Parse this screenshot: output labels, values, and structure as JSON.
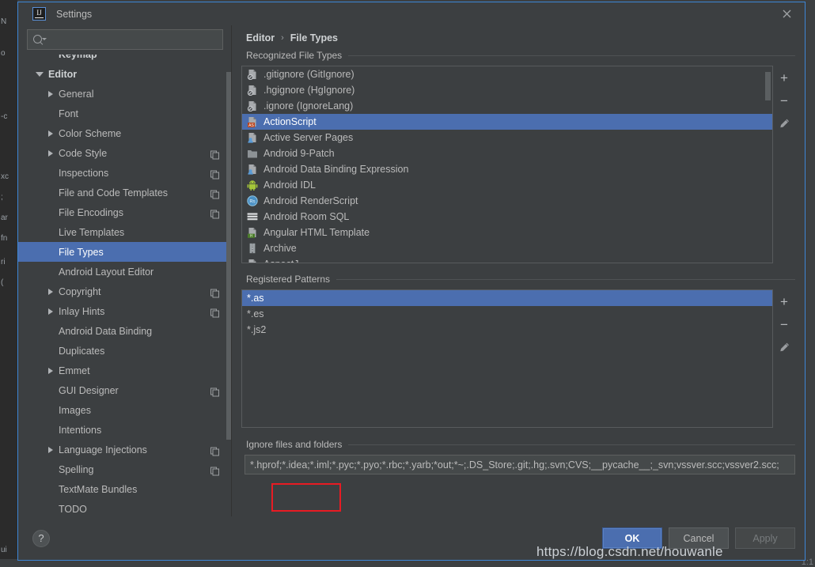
{
  "window": {
    "title": "Settings",
    "logo_text": "IJ",
    "close_icon": "close-icon"
  },
  "search": {
    "value": "",
    "placeholder": "",
    "icon": "search-icon"
  },
  "sidebar": {
    "items": [
      {
        "label": "Keymap",
        "indent": 1,
        "arrow": "none",
        "bold": true,
        "copy": false,
        "selected": false
      },
      {
        "label": "Editor",
        "indent": 0,
        "arrow": "expanded",
        "bold": true,
        "copy": false,
        "selected": false
      },
      {
        "label": "General",
        "indent": 1,
        "arrow": "collapsed",
        "bold": false,
        "copy": false,
        "selected": false
      },
      {
        "label": "Font",
        "indent": 1,
        "arrow": "none",
        "bold": false,
        "copy": false,
        "selected": false
      },
      {
        "label": "Color Scheme",
        "indent": 1,
        "arrow": "collapsed",
        "bold": false,
        "copy": false,
        "selected": false
      },
      {
        "label": "Code Style",
        "indent": 1,
        "arrow": "collapsed",
        "bold": false,
        "copy": true,
        "selected": false
      },
      {
        "label": "Inspections",
        "indent": 1,
        "arrow": "none",
        "bold": false,
        "copy": true,
        "selected": false
      },
      {
        "label": "File and Code Templates",
        "indent": 1,
        "arrow": "none",
        "bold": false,
        "copy": true,
        "selected": false
      },
      {
        "label": "File Encodings",
        "indent": 1,
        "arrow": "none",
        "bold": false,
        "copy": true,
        "selected": false
      },
      {
        "label": "Live Templates",
        "indent": 1,
        "arrow": "none",
        "bold": false,
        "copy": false,
        "selected": false
      },
      {
        "label": "File Types",
        "indent": 1,
        "arrow": "none",
        "bold": false,
        "copy": false,
        "selected": true
      },
      {
        "label": "Android Layout Editor",
        "indent": 1,
        "arrow": "none",
        "bold": false,
        "copy": false,
        "selected": false
      },
      {
        "label": "Copyright",
        "indent": 1,
        "arrow": "collapsed",
        "bold": false,
        "copy": true,
        "selected": false
      },
      {
        "label": "Inlay Hints",
        "indent": 1,
        "arrow": "collapsed",
        "bold": false,
        "copy": true,
        "selected": false
      },
      {
        "label": "Android Data Binding",
        "indent": 1,
        "arrow": "none",
        "bold": false,
        "copy": false,
        "selected": false
      },
      {
        "label": "Duplicates",
        "indent": 1,
        "arrow": "none",
        "bold": false,
        "copy": false,
        "selected": false
      },
      {
        "label": "Emmet",
        "indent": 1,
        "arrow": "collapsed",
        "bold": false,
        "copy": false,
        "selected": false
      },
      {
        "label": "GUI Designer",
        "indent": 1,
        "arrow": "none",
        "bold": false,
        "copy": true,
        "selected": false
      },
      {
        "label": "Images",
        "indent": 1,
        "arrow": "none",
        "bold": false,
        "copy": false,
        "selected": false
      },
      {
        "label": "Intentions",
        "indent": 1,
        "arrow": "none",
        "bold": false,
        "copy": false,
        "selected": false
      },
      {
        "label": "Language Injections",
        "indent": 1,
        "arrow": "collapsed",
        "bold": false,
        "copy": true,
        "selected": false
      },
      {
        "label": "Spelling",
        "indent": 1,
        "arrow": "none",
        "bold": false,
        "copy": true,
        "selected": false
      },
      {
        "label": "TextMate Bundles",
        "indent": 1,
        "arrow": "none",
        "bold": false,
        "copy": false,
        "selected": false
      },
      {
        "label": "TODO",
        "indent": 1,
        "arrow": "none",
        "bold": false,
        "copy": false,
        "selected": false
      }
    ]
  },
  "breadcrumb": {
    "root": "Editor",
    "separator": "›",
    "current": "File Types"
  },
  "recognized": {
    "title": "Recognized File Types",
    "items": [
      {
        "label": ".gitignore (GitIgnore)",
        "icon": "ignore-file-icon",
        "selected": false
      },
      {
        "label": ".hgignore (HgIgnore)",
        "icon": "ignore-file-icon",
        "selected": false
      },
      {
        "label": ".ignore (IgnoreLang)",
        "icon": "ignore-file-icon",
        "selected": false
      },
      {
        "label": "ActionScript",
        "icon": "actionscript-icon",
        "selected": true
      },
      {
        "label": "Active Server Pages",
        "icon": "asp-icon",
        "selected": false
      },
      {
        "label": "Android 9-Patch",
        "icon": "folder-icon",
        "selected": false
      },
      {
        "label": "Android Data Binding Expression",
        "icon": "databinding-icon",
        "selected": false
      },
      {
        "label": "Android IDL",
        "icon": "android-icon",
        "selected": false
      },
      {
        "label": "Android RenderScript",
        "icon": "renderscript-icon",
        "selected": false
      },
      {
        "label": "Android Room SQL",
        "icon": "sql-icon",
        "selected": false
      },
      {
        "label": "Angular HTML Template",
        "icon": "angular-html-icon",
        "selected": false
      },
      {
        "label": "Archive",
        "icon": "archive-icon",
        "selected": false
      },
      {
        "label": "AspectJ",
        "icon": "aspectj-icon",
        "selected": false
      }
    ],
    "tools": [
      {
        "name": "add-file-type-button",
        "glyph": "+"
      },
      {
        "name": "remove-file-type-button",
        "glyph": "−"
      },
      {
        "name": "edit-file-type-button",
        "glyph": "pencil"
      }
    ]
  },
  "patterns": {
    "title": "Registered Patterns",
    "items": [
      {
        "label": "*.as",
        "selected": true
      },
      {
        "label": "*.es",
        "selected": false
      },
      {
        "label": "*.js2",
        "selected": false
      }
    ],
    "tools": [
      {
        "name": "add-pattern-button",
        "glyph": "+"
      },
      {
        "name": "remove-pattern-button",
        "glyph": "−"
      },
      {
        "name": "edit-pattern-button",
        "glyph": "pencil"
      }
    ]
  },
  "ignore": {
    "title": "Ignore files and folders",
    "value": "*.hprof;*.idea;*.iml;*.pyc;*.pyo;*.rbc;*.yarb;*out;*~;.DS_Store;.git;.hg;.svn;CVS;__pycache__;_svn;vssver.scc;vssver2.scc;",
    "placeholder": "",
    "highlight_color": "#e81b23"
  },
  "footer": {
    "help_label": "?",
    "ok_label": "OK",
    "cancel_label": "Cancel",
    "apply_label": "Apply"
  },
  "watermark": {
    "text": "https://blog.csdn.net/houwanle"
  },
  "backdrop": {
    "left_fragments": [
      "N",
      "o",
      "-c",
      "xc",
      ";",
      "ar",
      "fn",
      "ri",
      "(",
      "ui"
    ],
    "corner_text": "1:1",
    "accent": "#4b6eaf"
  }
}
